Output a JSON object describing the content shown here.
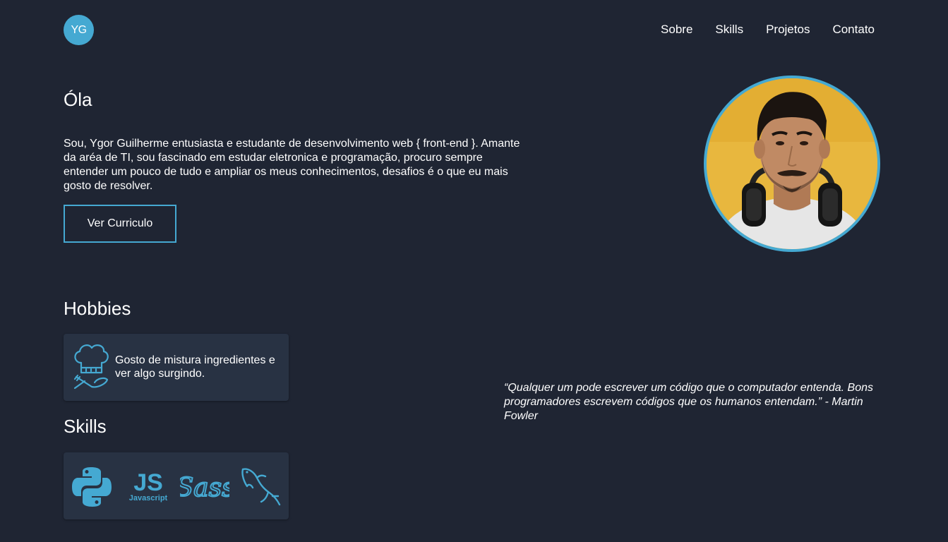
{
  "header": {
    "logo_text": "YG",
    "nav": [
      "Sobre",
      "Skills",
      "Projetos",
      "Contato"
    ]
  },
  "intro": {
    "greeting": "Óla",
    "text": "Sou, Ygor Guilherme entusiasta e estudante de desenvolvimento web { front-end }. Amante da aréa de TI, sou fascinado em estudar eletronica e programação, procuro sempre entender um pouco de tudo e ampliar os meus conhecimentos, desafios é o que eu mais gosto de resolver.",
    "button_label": "Ver Curriculo"
  },
  "hobbies": {
    "title": "Hobbies",
    "items": [
      {
        "icon": "chef-icon",
        "text": "Gosto de mistura ingredientes e ver algo surgindo."
      }
    ]
  },
  "skills": {
    "title": "Skills",
    "icons": [
      "python-icon",
      "javascript-icon",
      "sass-icon",
      "mysql-icon"
    ],
    "javascript_abbr": "JS",
    "javascript_label": "Javascript",
    "sass_label": "Sass"
  },
  "quote": {
    "text": "“Qualquer um pode escrever um código que o computador entenda. Bons programadores escrevem códigos que os humanos entendam.” - Martin Fowler"
  },
  "colors": {
    "background": "#1f2533",
    "card": "#283243",
    "accent": "#45a9d2",
    "text": "#ffffff"
  }
}
